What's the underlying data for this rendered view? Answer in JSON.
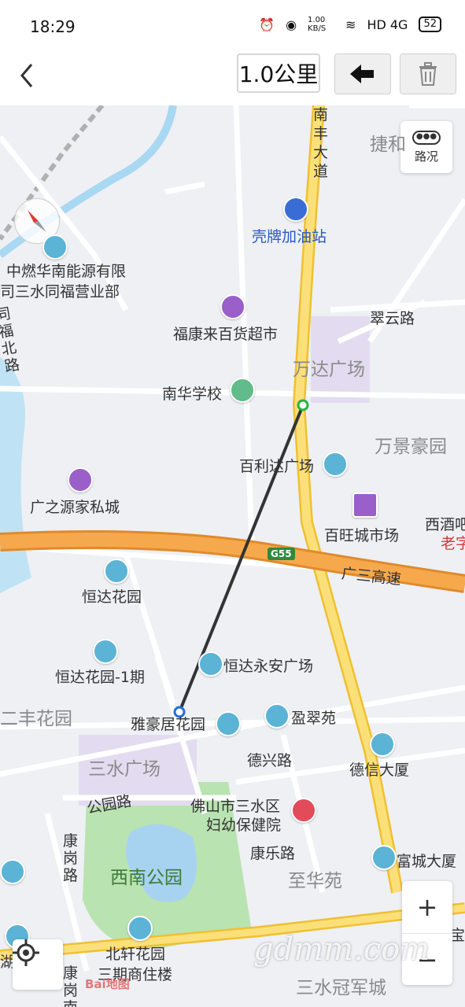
{
  "status": {
    "time": "18:29",
    "net_speed": "1.00 KB/S",
    "signal": "HD 4G",
    "battery": "52"
  },
  "toolbar": {
    "distance": "1.0公里"
  },
  "map": {
    "labels": {
      "road_nanfeng": "南丰大道",
      "road_jie": "捷和",
      "gas_station": "壳牌加油站",
      "energy1": "中燃华南能源有限",
      "energy2": "司三水同福营业部",
      "road_tongfu": "同福北路",
      "supermarket": "福康来百货超市",
      "road_cuiyun": "翠云路",
      "wanda": "万达广场",
      "school": "南华学校",
      "wanjing": "万景豪园",
      "bailida": "百利达广场",
      "furniture": "广之源家私城",
      "baiwang": "百旺城市场",
      "xijiu": "西酒吧",
      "laozi": "老字",
      "highway": "广三高速",
      "highway_code": "G55",
      "hengda": "恒达花园",
      "hengda1": "恒达花园-1期",
      "hengda_yongan": "恒达永安广场",
      "erfeng": "二丰花园",
      "yahao": "雅豪居花园",
      "yingcui": "盈翠苑",
      "sanshui_plaza": "三水广场",
      "dexing": "德兴路",
      "dexin": "德信大厦",
      "gongyuan_road": "公园路",
      "hospital1": "佛山市三水区",
      "hospital2": "妇幼保健院",
      "kanggang": "康岗路",
      "kangle": "康乐路",
      "fucheng": "富城大厦",
      "xinan_park": "西南公园",
      "zhihua": "至华苑",
      "beixuan1": "北轩花园",
      "beixuan2": "三期商住楼",
      "guanjun": "三水冠军城",
      "lake": "湖",
      "kanggang2": "康岗南",
      "bao": "宝"
    },
    "traffic": "路况",
    "zoom_in": "+",
    "zoom_out": "−",
    "watermark": "gdmm.com",
    "baidu_logo": "Bai地图"
  },
  "colors": {
    "highway": "#f0a044",
    "arterial": "#f7d24a",
    "park": "#b9e3b0",
    "water": "#bfe3f5",
    "measure_line": "#333333"
  }
}
